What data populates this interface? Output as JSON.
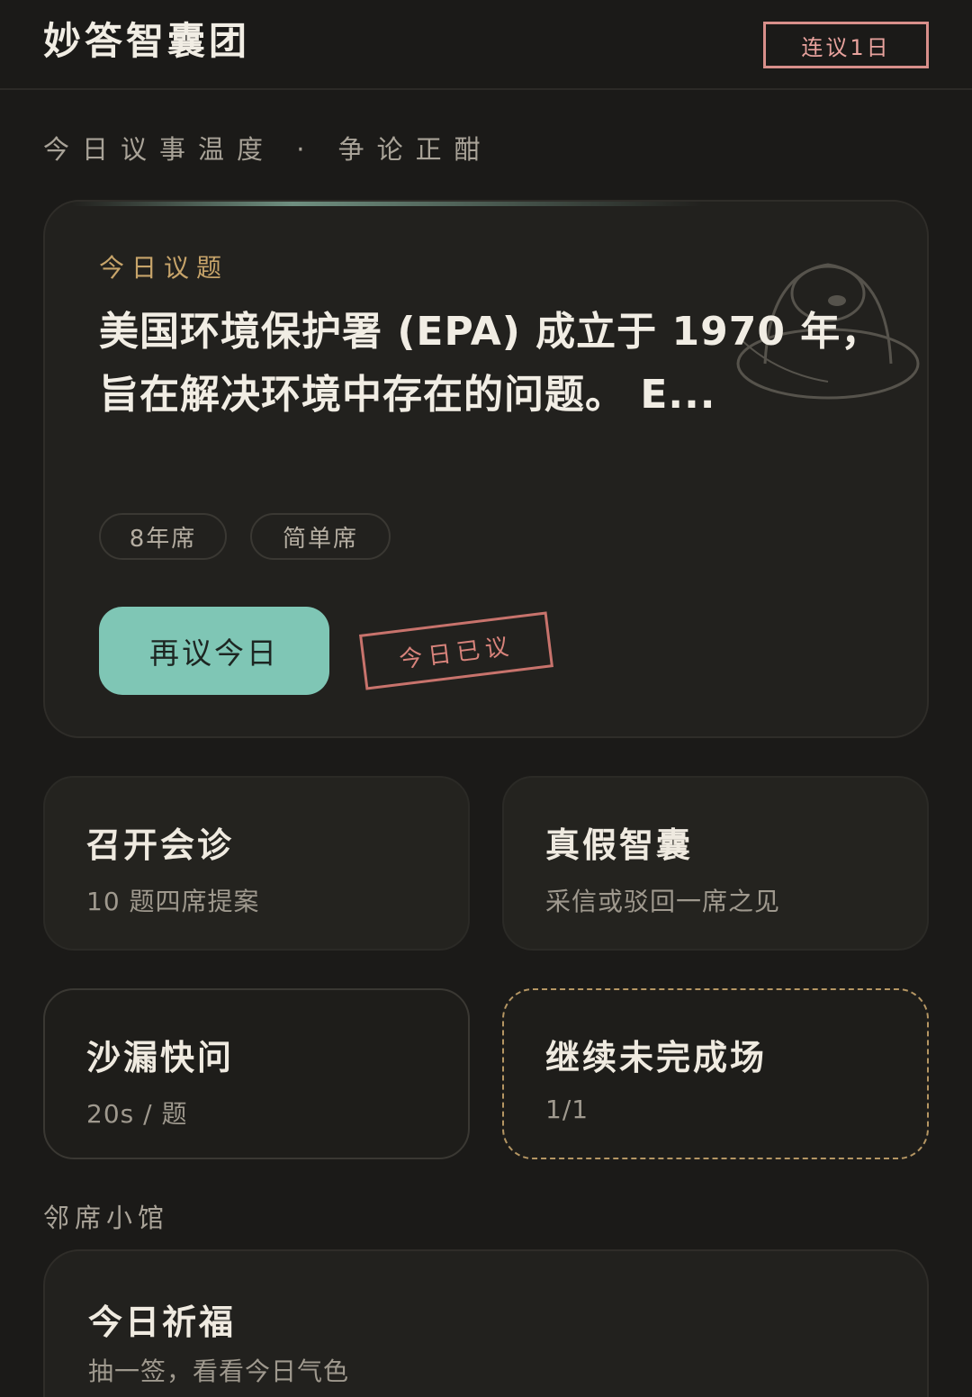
{
  "header": {
    "app_title": "妙答智囊团",
    "streak_badge": "连议1日"
  },
  "temperature_line": "今日议事温度 · 争论正酣",
  "topic_card": {
    "label": "今日议题",
    "text": "美国环境保护署 (EPA) 成立于 1970 年，旨在解决环境中存在的问题。 E...",
    "tags": [
      "8年席",
      "简单席"
    ],
    "redo_button": "再议今日",
    "done_stamp": "今日已议"
  },
  "cards": {
    "consult": {
      "title": "召开会诊",
      "subtitle": "10 题四席提案"
    },
    "truth": {
      "title": "真假智囊",
      "subtitle": "采信或驳回一席之见"
    },
    "hourglass": {
      "title": "沙漏快问",
      "subtitle": "20s / 题"
    },
    "resume": {
      "title": "继续未完成场",
      "subtitle": "1/1"
    }
  },
  "neighbor_section": {
    "title": "邻席小馆",
    "blessing": {
      "title": "今日祈福",
      "subtitle": "抽一签，看看今日气色"
    }
  },
  "colors": {
    "background": "#1b1a18",
    "accent_mint": "#7fc6b5",
    "stamp_red": "#d88f8a",
    "gold_label": "#c7a46a"
  }
}
